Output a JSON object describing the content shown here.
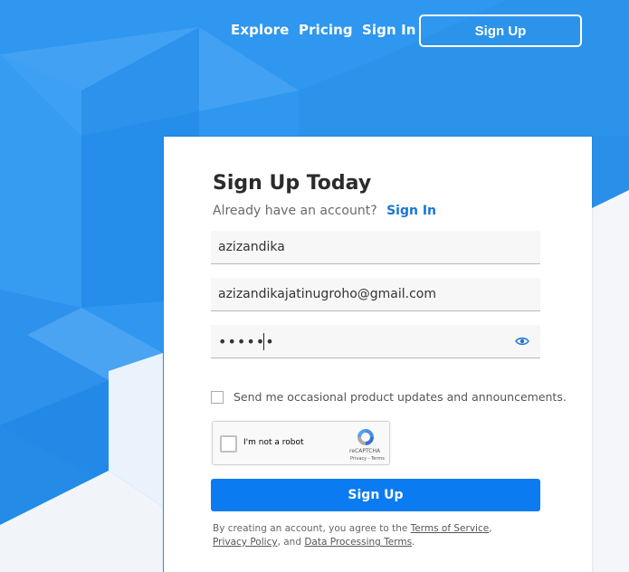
{
  "nav": {
    "explore": "Explore",
    "pricing": "Pricing",
    "signin": "Sign In",
    "signup": "Sign Up"
  },
  "form": {
    "title": "Sign Up Today",
    "already": "Already have an account?",
    "signin_link": "Sign In",
    "username": "azizandika",
    "email": "azizandikajatinugroho@gmail.com",
    "password_masked": "••••••",
    "updates_label": "Send me occasional product updates and announcements.",
    "updates_checked": false,
    "captcha": {
      "label": "I'm not a robot",
      "brand": "reCAPTCHA",
      "links": "Privacy - Terms"
    },
    "submit": "Sign Up",
    "legal": {
      "prefix": "By creating an account, you agree to the",
      "terms": "Terms of Service",
      "comma": ",",
      "privacy": "Privacy Policy",
      "and": ", and",
      "dpt": "Data Processing Terms",
      "end": "."
    }
  },
  "colors": {
    "background": "#2f97ef",
    "accent": "#0a7bf0",
    "link": "#1a76d2"
  },
  "icons": {
    "eye": "eye-icon",
    "captcha": "recaptcha-logo-icon"
  }
}
